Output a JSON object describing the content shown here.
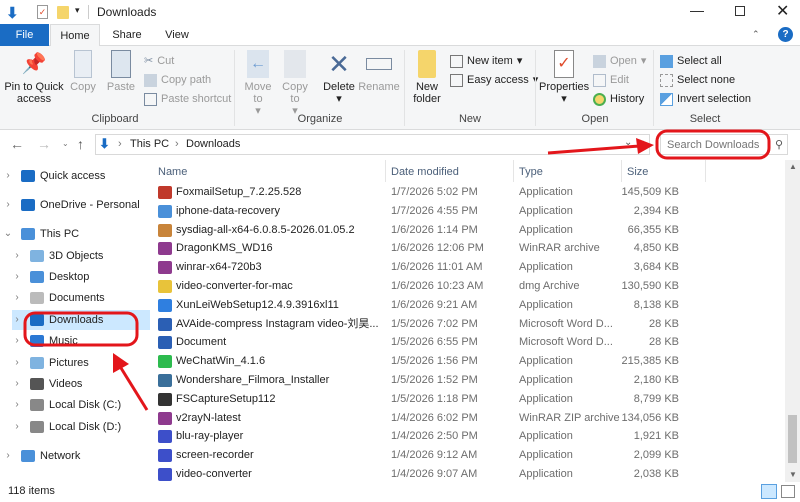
{
  "window": {
    "title": "Downloads"
  },
  "tabs": {
    "file": "File",
    "home": "Home",
    "share": "Share",
    "view": "View"
  },
  "ribbon": {
    "clipboard": {
      "label": "Clipboard",
      "pin": "Pin to Quick access",
      "copy": "Copy",
      "paste": "Paste",
      "cut": "Cut",
      "copy_path": "Copy path",
      "paste_shortcut": "Paste shortcut"
    },
    "organize": {
      "label": "Organize",
      "move_to": "Move to",
      "copy_to": "Copy to",
      "delete": "Delete",
      "rename": "Rename"
    },
    "new": {
      "label": "New",
      "new_folder": "New folder",
      "new_item": "New item",
      "easy_access": "Easy access"
    },
    "open": {
      "label": "Open",
      "properties": "Properties",
      "open": "Open",
      "edit": "Edit",
      "history": "History"
    },
    "select": {
      "label": "Select",
      "select_all": "Select all",
      "select_none": "Select none",
      "invert": "Invert selection"
    }
  },
  "address": {
    "crumbs": [
      "This PC",
      "Downloads"
    ]
  },
  "search": {
    "placeholder": "Search Downloads"
  },
  "nav": [
    {
      "label": "Quick access",
      "icon": "star-icon",
      "level": 0
    },
    {
      "label": "OneDrive - Personal",
      "icon": "cloud-icon",
      "level": 0
    },
    {
      "label": "This PC",
      "icon": "computer-icon",
      "level": 0,
      "expanded": true
    },
    {
      "label": "3D Objects",
      "icon": "cube-icon",
      "level": 1
    },
    {
      "label": "Desktop",
      "icon": "desktop-icon",
      "level": 1
    },
    {
      "label": "Documents",
      "icon": "documents-icon",
      "level": 1
    },
    {
      "label": "Downloads",
      "icon": "download-icon",
      "level": 1,
      "selected": true
    },
    {
      "label": "Music",
      "icon": "music-icon",
      "level": 1
    },
    {
      "label": "Pictures",
      "icon": "pictures-icon",
      "level": 1
    },
    {
      "label": "Videos",
      "icon": "videos-icon",
      "level": 1
    },
    {
      "label": "Local Disk (C:)",
      "icon": "drive-icon",
      "level": 1
    },
    {
      "label": "Local Disk (D:)",
      "icon": "drive-icon",
      "level": 1
    },
    {
      "label": "Network",
      "icon": "network-icon",
      "level": 0
    }
  ],
  "columns": {
    "name": "Name",
    "date": "Date modified",
    "type": "Type",
    "size": "Size"
  },
  "files": [
    {
      "name": "FoxmailSetup_7.2.25.528",
      "date": "1/7/2026 5:02 PM",
      "type": "Application",
      "size": "145,509 KB",
      "color": "#c0392b"
    },
    {
      "name": "iphone-data-recovery",
      "date": "1/7/2026 4:55 PM",
      "type": "Application",
      "size": "2,394 KB",
      "color": "#4a90d9"
    },
    {
      "name": "sysdiag-all-x64-6.0.8.5-2026.01.05.2",
      "date": "1/6/2026 1:14 PM",
      "type": "Application",
      "size": "66,355 KB",
      "color": "#c8843a"
    },
    {
      "name": "DragonKMS_WD16",
      "date": "1/6/2026 12:06 PM",
      "type": "WinRAR archive",
      "size": "4,850 KB",
      "color": "#8e3a8e"
    },
    {
      "name": "winrar-x64-720b3",
      "date": "1/6/2026 11:01 AM",
      "type": "Application",
      "size": "3,684 KB",
      "color": "#8e3a8e"
    },
    {
      "name": "video-converter-for-mac",
      "date": "1/6/2026 10:23 AM",
      "type": "dmg Archive",
      "size": "130,590 KB",
      "color": "#e8c33a"
    },
    {
      "name": "XunLeiWebSetup12.4.9.3916xl11",
      "date": "1/6/2026 9:21 AM",
      "type": "Application",
      "size": "8,138 KB",
      "color": "#2f7fe0"
    },
    {
      "name": "AVAide-compress Instagram video-刘昊...",
      "date": "1/5/2026 7:02 PM",
      "type": "Microsoft Word D...",
      "size": "28 KB",
      "color": "#2b5fb4"
    },
    {
      "name": "Document",
      "date": "1/5/2026 6:55 PM",
      "type": "Microsoft Word D...",
      "size": "28 KB",
      "color": "#2b5fb4"
    },
    {
      "name": "WeChatWin_4.1.6",
      "date": "1/5/2026 1:56 PM",
      "type": "Application",
      "size": "215,385 KB",
      "color": "#2dbb4e"
    },
    {
      "name": "Wondershare_Filmora_Installer",
      "date": "1/5/2026 1:52 PM",
      "type": "Application",
      "size": "2,180 KB",
      "color": "#3a6f9a"
    },
    {
      "name": "FSCaptureSetup112",
      "date": "1/5/2026 1:18 PM",
      "type": "Application",
      "size": "8,799 KB",
      "color": "#333333"
    },
    {
      "name": "v2rayN-latest",
      "date": "1/4/2026 6:02 PM",
      "type": "WinRAR ZIP archive",
      "size": "134,056 KB",
      "color": "#8e3a8e"
    },
    {
      "name": "blu-ray-player",
      "date": "1/4/2026 2:50 PM",
      "type": "Application",
      "size": "1,921 KB",
      "color": "#3d4fc9"
    },
    {
      "name": "screen-recorder",
      "date": "1/4/2026 9:12 AM",
      "type": "Application",
      "size": "2,099 KB",
      "color": "#3d4fc9"
    },
    {
      "name": "video-converter",
      "date": "1/4/2026 9:07 AM",
      "type": "Application",
      "size": "2,038 KB",
      "color": "#3d4fc9"
    }
  ],
  "status": {
    "count": "118 items"
  },
  "colors": {
    "accent": "#1a6cc4",
    "annotation": "#e3161b",
    "selected": "#cce8ff"
  }
}
